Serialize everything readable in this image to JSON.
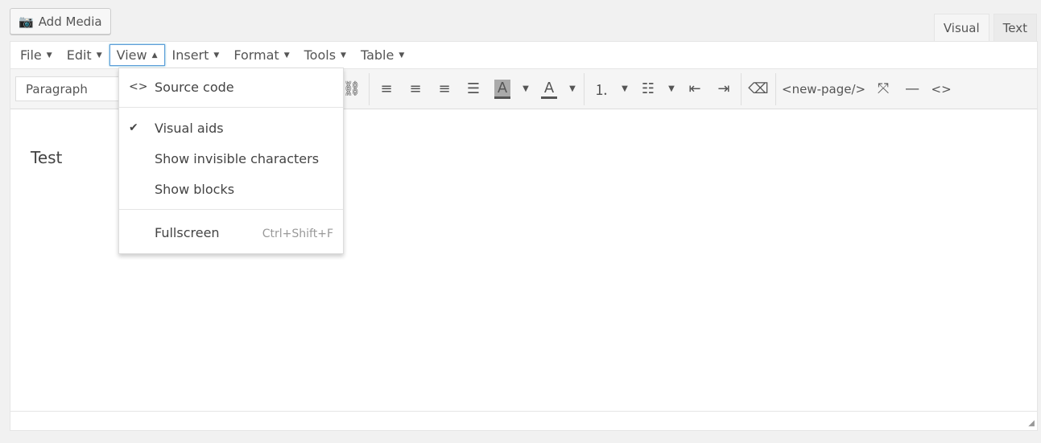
{
  "add_media": {
    "label": "Add Media",
    "icon": "media-icon"
  },
  "tabs": [
    {
      "label": "Visual",
      "active": true
    },
    {
      "label": "Text",
      "active": false
    }
  ],
  "menubar": [
    {
      "label": "File",
      "caret": "▼"
    },
    {
      "label": "Edit",
      "caret": "▼"
    },
    {
      "label": "View",
      "caret": "▲"
    },
    {
      "label": "Insert",
      "caret": "▼"
    },
    {
      "label": "Format",
      "caret": "▼"
    },
    {
      "label": "Tools",
      "caret": "▼"
    },
    {
      "label": "Table",
      "caret": "▼"
    }
  ],
  "toolbar": {
    "format_select": "Paragraph",
    "new_page": "<new-page/>",
    "code": "<>",
    "hr": "—"
  },
  "dropdown": {
    "source_code": "Source code",
    "source_icon": "<>",
    "visual_aids": "Visual aids",
    "check": "✔",
    "invisible": "Show invisible characters",
    "blocks": "Show blocks",
    "fullscreen": "Fullscreen",
    "fullscreen_shortcut": "Ctrl+Shift+F"
  },
  "content": {
    "text": "Test"
  }
}
